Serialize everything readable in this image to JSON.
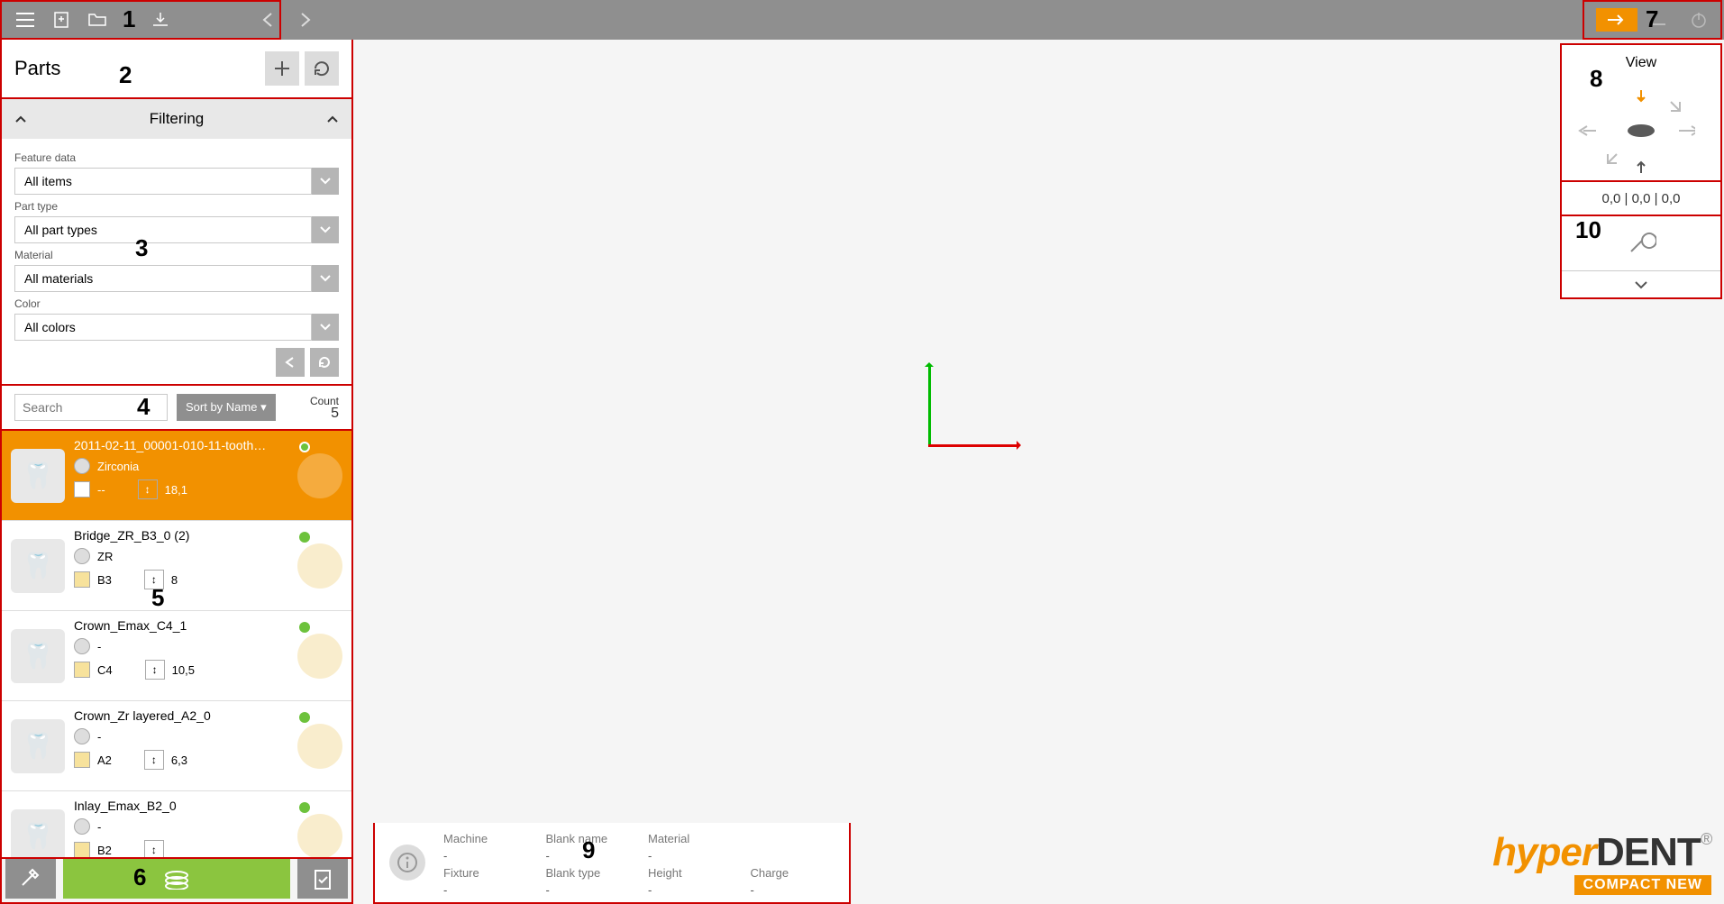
{
  "header": {
    "parts_title": "Parts"
  },
  "filtering": {
    "title": "Filtering",
    "feature_data_label": "Feature data",
    "feature_data_value": "All items",
    "part_type_label": "Part type",
    "part_type_value": "All part types",
    "material_label": "Material",
    "material_value": "All materials",
    "color_label": "Color",
    "color_value": "All colors"
  },
  "search": {
    "placeholder": "Search",
    "sort_label": "Sort by Name ▾",
    "count_label": "Count",
    "count_value": "5"
  },
  "parts": [
    {
      "name": "2011-02-11_00001-010-11-tooth…",
      "material": "Zirconia",
      "color": "--",
      "height": "18,1",
      "selected": true
    },
    {
      "name": "Bridge_ZR_B3_0 (2)",
      "material": "ZR",
      "color": "B3",
      "height": "8",
      "selected": false
    },
    {
      "name": "Crown_Emax_C4_1",
      "material": "-",
      "color": "C4",
      "height": "10,5",
      "selected": false
    },
    {
      "name": "Crown_Zr layered_A2_0",
      "material": "-",
      "color": "A2",
      "height": "6,3",
      "selected": false
    },
    {
      "name": "Inlay_Emax_B2_0",
      "material": "-",
      "color": "B2",
      "height": "",
      "selected": false
    }
  ],
  "info": {
    "machine_label": "Machine",
    "machine_value": "-",
    "blankname_label": "Blank name",
    "blankname_value": "-",
    "material_label": "Material",
    "material_value": "-",
    "fixture_label": "Fixture",
    "fixture_value": "-",
    "blanktype_label": "Blank type",
    "blanktype_value": "-",
    "height_label": "Height",
    "height_value": "-",
    "charge_label": "Charge",
    "charge_value": "-"
  },
  "view": {
    "title": "View",
    "coords": "0,0  |  0,0  |  0,0"
  },
  "logo": {
    "brand_pre": "hyper",
    "brand_post": "DENT",
    "reg": "®",
    "sub": "COMPACT NEW"
  },
  "annotations": {
    "a1": "1",
    "a2": "2",
    "a3": "3",
    "a4": "4",
    "a5": "5",
    "a6": "6",
    "a7": "7",
    "a8": "8",
    "a9": "9",
    "a10": "10"
  },
  "swatch_colors": {
    "zirconia": "#ffffff",
    "b3": "#f7e29c",
    "c4": "#f7e29c",
    "a2": "#f7e29c",
    "b2": "#f7e29c"
  }
}
